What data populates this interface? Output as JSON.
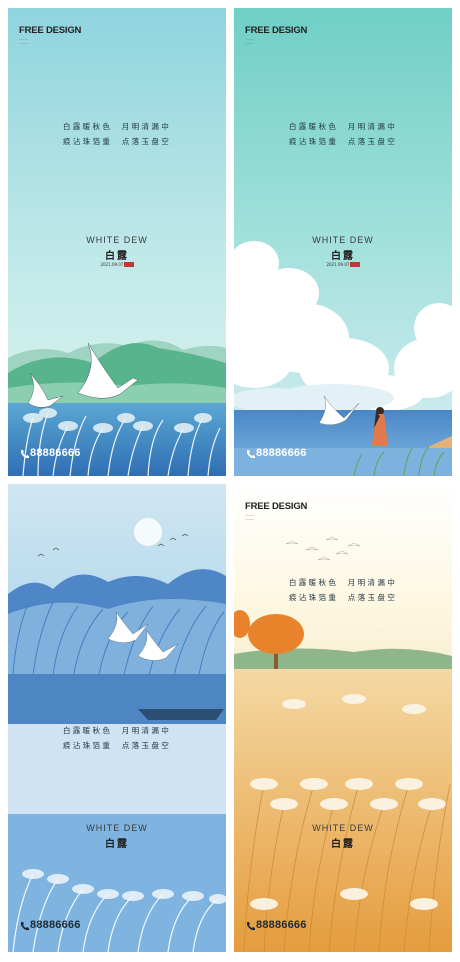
{
  "brand": "FREE DESIGN",
  "poem": {
    "line1": "白露暖秋色  月明清漏中",
    "line2": "痕沾珠箔重  点落玉盘空"
  },
  "title_en": "WHITE DEW",
  "title_cn": "白露",
  "date": "2021.09.07",
  "phone": "88886666",
  "icons": [
    "phone-icon",
    "seal-icon",
    "moon-icon",
    "bird-icon"
  ],
  "colors": {
    "poster1_sky": "#a8dde3",
    "poster2_sky": "#7fd3cc",
    "poster3_sky": "#b8dcef",
    "poster4_sky": "#fdf8ea",
    "seal": "#c8323a"
  }
}
